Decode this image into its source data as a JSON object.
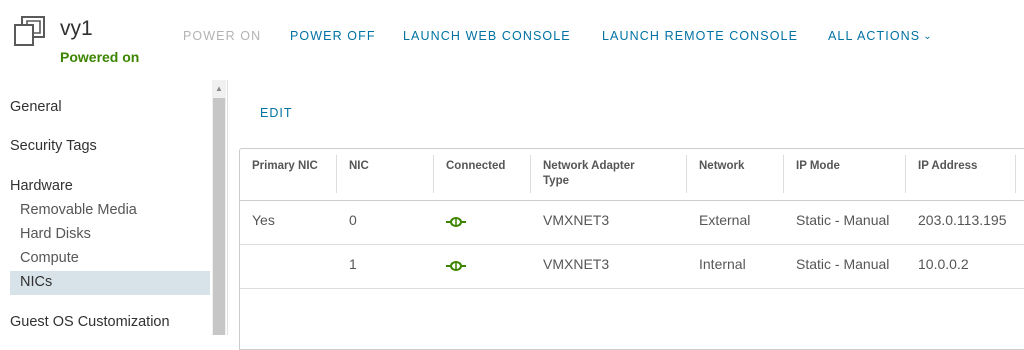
{
  "vm": {
    "name": "vy1",
    "status": "Powered on"
  },
  "toolbar": {
    "power_on": "POWER ON",
    "power_off": "POWER OFF",
    "launch_web_console": "LAUNCH WEB CONSOLE",
    "launch_remote_console": "LAUNCH REMOTE CONSOLE",
    "all_actions": "ALL ACTIONS"
  },
  "sidebar": {
    "general": "General",
    "security_tags": "Security Tags",
    "hardware": "Hardware",
    "removable_media": "Removable Media",
    "hard_disks": "Hard Disks",
    "compute": "Compute",
    "nics": "NICs",
    "guest_os": "Guest OS Customization",
    "selected": "NICs"
  },
  "main": {
    "edit_label": "EDIT",
    "columns": [
      "Primary NIC",
      "NIC",
      "Connected",
      "Network Adapter Type",
      "Network",
      "IP Mode",
      "IP Address"
    ],
    "rows": [
      {
        "primary": "Yes",
        "nic": "0",
        "connected": true,
        "adapter": "VMXNET3",
        "network": "External",
        "ip_mode": "Static - Manual",
        "ip": "203.0.113.195"
      },
      {
        "primary": "",
        "nic": "1",
        "connected": true,
        "adapter": "VMXNET3",
        "network": "Internal",
        "ip_mode": "Static - Manual",
        "ip": "10.0.0.2"
      }
    ]
  },
  "colors": {
    "accent": "#0072a3",
    "status_green": "#3c8500",
    "connected_icon": "#3c8500",
    "selected_bg": "#d8e3e9"
  },
  "icons": {
    "vm": "vm-icon",
    "connected": "connected-link-icon",
    "chevron": "chevron-down-icon",
    "scroll_up": "scroll-up-arrow-icon"
  }
}
